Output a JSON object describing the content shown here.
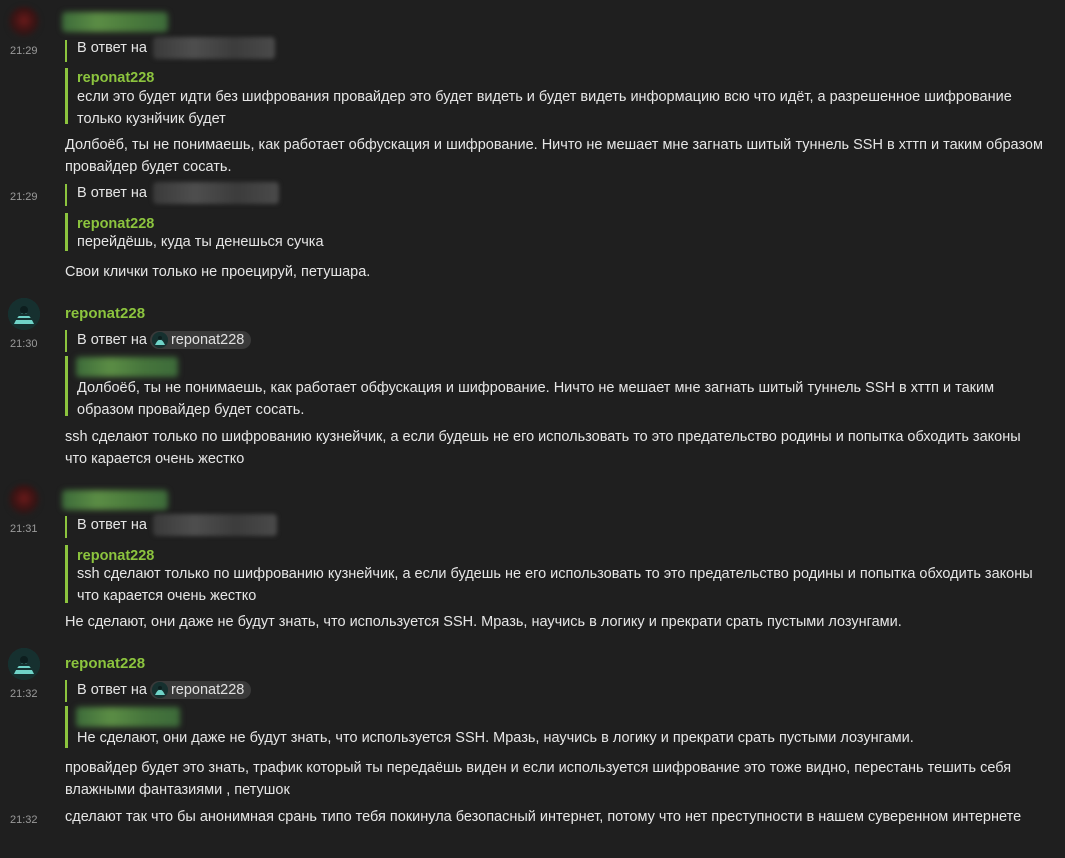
{
  "reply_prefix": "В ответ на",
  "self_name": "reponat228",
  "groups": [
    {
      "time1": "21:29",
      "quote1_author": "reponat228",
      "quote1_text": "если это будет идти без шифрования провайдер это будет видеть и будет видеть информацию всю что идёт, а разрешенное шифрование только кузнйчик будет",
      "msg1": "Долбоёб, ты не понимаешь, как работает обфускация и шифрование. Ничто не мешает мне загнать шитый туннель SSH в хттп и таким образом провайдер будет сосать.",
      "time2": "21:29",
      "quote2_author": "reponat228",
      "quote2_text": "перейдёшь, куда ты денешься сучка",
      "msg2": "Свои клички только не проецируй, петушара."
    },
    {
      "author": "reponat228",
      "time": "21:30",
      "mention": "reponat228",
      "quote_text": "Долбоёб, ты не понимаешь, как работает обфускация и шифрование. Ничто не мешает мне загнать шитый туннель SSH в хттп и таким образом провайдер будет сосать.",
      "msg": "ssh сделают только по шифрованию кузнейчик, а если будешь не его использовать то это предательство родины и попытка обходить законы что карается очень жестко"
    },
    {
      "time": "21:31",
      "quote_author": "reponat228",
      "quote_text": "ssh сделают только по шифрованию кузнейчик, а если будешь не его использовать то это предательство родины и попытка обходить законы что карается очень жестко",
      "msg": "Не сделают, они даже не будут знать, что используется SSH. Мразь, научись в логику и прекрати срать пустыми лозунгами."
    },
    {
      "author": "reponat228",
      "time": "21:32",
      "mention": "reponat228",
      "quote_text": "Не сделают, они даже не будут знать, что используется SSH. Мразь, научись в логику и прекрати срать пустыми лозунгами.",
      "msg": "провайдер будет это знать, трафик который ты передаёшь виден и если используется шифрование это тоже видно, перестань тешить себя влажными фантазиями , петушок",
      "time2": "21:32",
      "msg2": "сделают так что бы анонимная срань типо тебя покинула безопасный интернет, потому что нет преступности в нашем суверенном интернете"
    }
  ],
  "colors": {
    "background": "#1f1f1f",
    "accent": "#8cc43e",
    "text": "#e6e6e6",
    "timestamp": "#9a9a9a"
  },
  "icons": {
    "avatar_self": "reponat228-avatar"
  }
}
